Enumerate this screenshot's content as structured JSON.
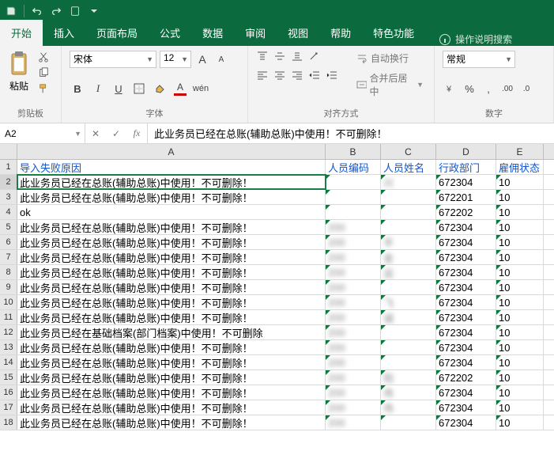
{
  "titlebar": {
    "qat": [
      "save",
      "undo",
      "redo",
      "touch",
      "more"
    ]
  },
  "tabs": {
    "items": [
      "开始",
      "插入",
      "页面布局",
      "公式",
      "数据",
      "审阅",
      "视图",
      "帮助",
      "特色功能"
    ],
    "activeIndex": 0,
    "tell_me": "操作说明搜索"
  },
  "ribbon": {
    "clipboard": {
      "label": "剪贴板",
      "paste": "粘贴"
    },
    "font": {
      "label": "字体",
      "name": "宋体",
      "size": "12",
      "bold": "B",
      "italic": "I",
      "underline": "U"
    },
    "alignment": {
      "label": "对齐方式",
      "wrap": "自动换行",
      "merge": "合并后居中"
    },
    "number": {
      "label": "数字",
      "format": "常规"
    }
  },
  "formula_bar": {
    "name_box": "A2",
    "cancel": "✕",
    "enter": "✓",
    "fx": "fx",
    "content": "此业务员已经在总账(辅助总账)中使用！不可删除！"
  },
  "columns": [
    "A",
    "B",
    "C",
    "D",
    "E"
  ],
  "header_row": {
    "A": "导入失败原因",
    "B": "人员编码",
    "C": "人员姓名",
    "D": "行政部门",
    "E": "雇佣状态"
  },
  "rows": [
    {
      "n": 2,
      "A": "此业务员已经在总账(辅助总账)中使用！不可删除！",
      "B": "",
      "C": "  兴",
      "D": "672304",
      "E": "10",
      "sel": true
    },
    {
      "n": 3,
      "A": "此业务员已经在总账(辅助总账)中使用！不可删除！",
      "B": "",
      "C": "",
      "D": "672201",
      "E": "10"
    },
    {
      "n": 4,
      "A": "ok",
      "B": "",
      "C": "",
      "D": "672202",
      "E": "10"
    },
    {
      "n": 5,
      "A": "此业务员已经在总账(辅助总账)中使用！不可删除！",
      "B": "200",
      "C": "",
      "D": "672304",
      "E": "10"
    },
    {
      "n": 6,
      "A": "此业务员已经在总账(辅助总账)中使用！不可删除！",
      "B": "200",
      "C": "  平",
      "D": "672304",
      "E": "10"
    },
    {
      "n": 7,
      "A": "此业务员已经在总账(辅助总账)中使用！不可删除！",
      "B": "200",
      "C": "  金",
      "D": "672304",
      "E": "10"
    },
    {
      "n": 8,
      "A": "此业务员已经在总账(辅助总账)中使用！不可删除！",
      "B": "200",
      "C": "  运",
      "D": "672304",
      "E": "10"
    },
    {
      "n": 9,
      "A": "此业务员已经在总账(辅助总账)中使用！不可删除！",
      "B": "200",
      "C": "",
      "D": "672304",
      "E": "10"
    },
    {
      "n": 10,
      "A": "此业务员已经在总账(辅助总账)中使用！不可删除！",
      "B": "200",
      "C": "  飞",
      "D": "672304",
      "E": "10"
    },
    {
      "n": 11,
      "A": "此业务员已经在总账(辅助总账)中使用！不可删除！",
      "B": "200",
      "C": "  诚",
      "D": "672304",
      "E": "10"
    },
    {
      "n": 12,
      "A": "此业务员已经在基础档案(部门档案)中使用！不可删除",
      "B": "200",
      "C": "",
      "D": "672304",
      "E": "10"
    },
    {
      "n": 13,
      "A": "此业务员已经在总账(辅助总账)中使用！不可删除！",
      "B": "200",
      "C": "",
      "D": "672304",
      "E": "10"
    },
    {
      "n": 14,
      "A": "此业务员已经在总账(辅助总账)中使用！不可删除！",
      "B": "200",
      "C": "",
      "D": "672304",
      "E": "10"
    },
    {
      "n": 15,
      "A": "此业务员已经在总账(辅助总账)中使用！不可删除！",
      "B": "200",
      "C": "  阳",
      "D": "672202",
      "E": "10"
    },
    {
      "n": 16,
      "A": "此业务员已经在总账(辅助总账)中使用！不可删除！",
      "B": "200",
      "C": "  伟",
      "D": "672304",
      "E": "10"
    },
    {
      "n": 17,
      "A": "此业务员已经在总账(辅助总账)中使用！不可删除！",
      "B": "200",
      "C": "  伟",
      "D": "672304",
      "E": "10"
    },
    {
      "n": 18,
      "A": "此业务员已经在总账(辅助总账)中使用！不可删除！",
      "B": "200",
      "C": "",
      "D": "672304",
      "E": "10"
    }
  ]
}
